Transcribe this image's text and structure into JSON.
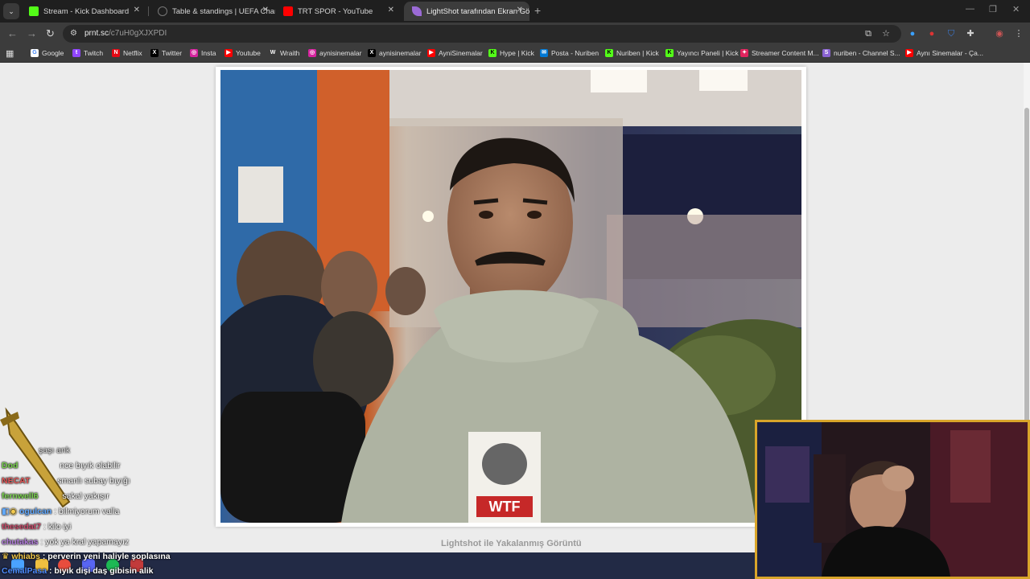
{
  "tabs": [
    {
      "title": "Stream - Kick Dashboard",
      "favicon_color": "#53fc18",
      "favicon": "kick-icon"
    },
    {
      "title": "Table & standings | UEFA Cham",
      "favicon_color": "#1f1f1f",
      "favicon": "uefa-icon"
    },
    {
      "title": "TRT SPOR - YouTube",
      "favicon_color": "#ff0000",
      "favicon": "youtube-icon"
    },
    {
      "title": "LightShot tarafından Ekran Görü",
      "favicon_color": "#9b6bd6",
      "favicon": "lightshot-feather-icon",
      "active": true
    }
  ],
  "address": {
    "host": "prnt.sc",
    "path": "/c7uH0gXJXPDI"
  },
  "bookmarks": [
    {
      "label": "Google",
      "color": "#4285f4",
      "glyph": "G"
    },
    {
      "label": "Twitch",
      "color": "#9146ff",
      "glyph": "t"
    },
    {
      "label": "Netflix",
      "color": "#e50914",
      "glyph": "N"
    },
    {
      "label": "Twitter",
      "color": "#000000",
      "glyph": "X"
    },
    {
      "label": "Insta",
      "color": "#d6249f",
      "glyph": "◎"
    },
    {
      "label": "Youtube",
      "color": "#ff0000",
      "glyph": "▶"
    },
    {
      "label": "Wraith",
      "color": "#3c3c3c",
      "glyph": "W"
    },
    {
      "label": "aynisinemalar",
      "color": "#d6249f",
      "glyph": "◎"
    },
    {
      "label": "aynisinemalar",
      "color": "#000000",
      "glyph": "X"
    },
    {
      "label": "AyniSinemalar",
      "color": "#ff0000",
      "glyph": "▶"
    },
    {
      "label": "Hype | Kick",
      "color": "#53fc18",
      "glyph": "K"
    },
    {
      "label": "Posta - Nuriben",
      "color": "#0078d4",
      "glyph": "✉"
    },
    {
      "label": "Nuriben | Kick",
      "color": "#53fc18",
      "glyph": "K"
    },
    {
      "label": "Yayıncı Paneli | Kick",
      "color": "#53fc18",
      "glyph": "K"
    },
    {
      "label": "Streamer Content M...",
      "color": "#e0245e",
      "glyph": "✦"
    },
    {
      "label": "nuriben - Channel S...",
      "color": "#8a63d2",
      "glyph": "S"
    },
    {
      "label": "Aynı Sinemalar - Ça...",
      "color": "#ff0000",
      "glyph": "▶"
    }
  ],
  "page": {
    "caption": "Lightshot ile Yakalanmış Görüntü"
  },
  "chat": [
    {
      "user": "",
      "user_color": "#cccccc",
      "message": "şaşı ank"
    },
    {
      "user": "Dod",
      "user_color": "#7ad34f",
      "message": "nce bıyık olabilir"
    },
    {
      "user": "NECAT",
      "user_color": "#e05555",
      "message": "smanlı subay bıyığı"
    },
    {
      "user": "fernwell6",
      "user_color": "#7ad34f",
      "message": "sakal yakışır"
    },
    {
      "user": "ogulcan",
      "user_color": "#5fa8ff",
      "message": ": bilmiyorum valla"
    },
    {
      "user": "thesedat7",
      "user_color": "#c94b6a",
      "message": ": kilo iyi"
    },
    {
      "user": "chutakas",
      "user_color": "#b07ad9",
      "message": ": yok ya kral yapamayız"
    },
    {
      "user": "whiabs",
      "user_color": "#f2c94c",
      "message": ": perverin yeni haliyle şoplasına"
    },
    {
      "user": "CemalPasa",
      "user_color": "#4f8cff",
      "message": ": bıyık dişi daş gibisin alik"
    }
  ]
}
